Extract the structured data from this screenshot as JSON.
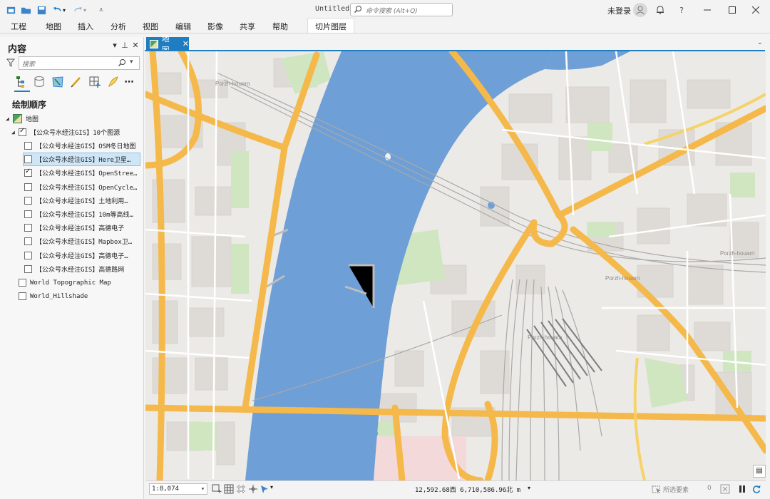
{
  "window": {
    "doc_title": "Untitled",
    "search_placeholder": "命令搜索 (Alt+Q)",
    "signin": "未登录"
  },
  "ribbon": {
    "tabs": [
      "工程",
      "地图",
      "插入",
      "分析",
      "视图",
      "编辑",
      "影像",
      "共享",
      "帮助"
    ],
    "contextual_tab": "切片图层"
  },
  "contents": {
    "title": "内容",
    "search_placeholder": "搜索",
    "section": "绘制顺序",
    "map_name": "地图",
    "group": "【公众号水经注GIS】10个图源",
    "layers": [
      {
        "label": "【公众号水经注GIS】OSM冬日地图",
        "checked": false,
        "selected": false
      },
      {
        "label": "【公众号水经注GIS】Here卫星…",
        "checked": false,
        "selected": true
      },
      {
        "label": "【公众号水经注GIS】OpenStree…",
        "checked": true,
        "selected": false
      },
      {
        "label": "【公众号水经注GIS】OpenCycle…",
        "checked": false,
        "selected": false
      },
      {
        "label": "【公众号水经注GIS】土地利用…",
        "checked": false,
        "selected": false
      },
      {
        "label": "【公众号水经注GIS】10m等高线…",
        "checked": false,
        "selected": false
      },
      {
        "label": "【公众号水经注GIS】高德电子",
        "checked": false,
        "selected": false
      },
      {
        "label": "【公众号水经注GIS】Mapbox卫…",
        "checked": false,
        "selected": false
      },
      {
        "label": "【公众号水经注GIS】高德电子…",
        "checked": false,
        "selected": false
      },
      {
        "label": "【公众号水经注GIS】高德路网",
        "checked": false,
        "selected": false
      }
    ],
    "basemaps": [
      {
        "label": "World Topographic Map",
        "checked": false
      },
      {
        "label": "World_Hillshade",
        "checked": false
      }
    ]
  },
  "map_view": {
    "tab_label": "地图",
    "place_labels": [
      "Porzh-houarn",
      "Porzh-houarn",
      "Porzh-houarn",
      "Porzh-houarn"
    ]
  },
  "status_bar": {
    "scale": "1:8,074",
    "coordinates": "12,592.68西 6,710,586.96北 m",
    "selected_features_label": "所选要素",
    "selected_count": "0"
  },
  "colors": {
    "accent": "#1f7ec2",
    "water": "#6e9fd6",
    "road_major": "#f5b84a",
    "land": "#eceae6",
    "park": "#cfe6c1"
  }
}
